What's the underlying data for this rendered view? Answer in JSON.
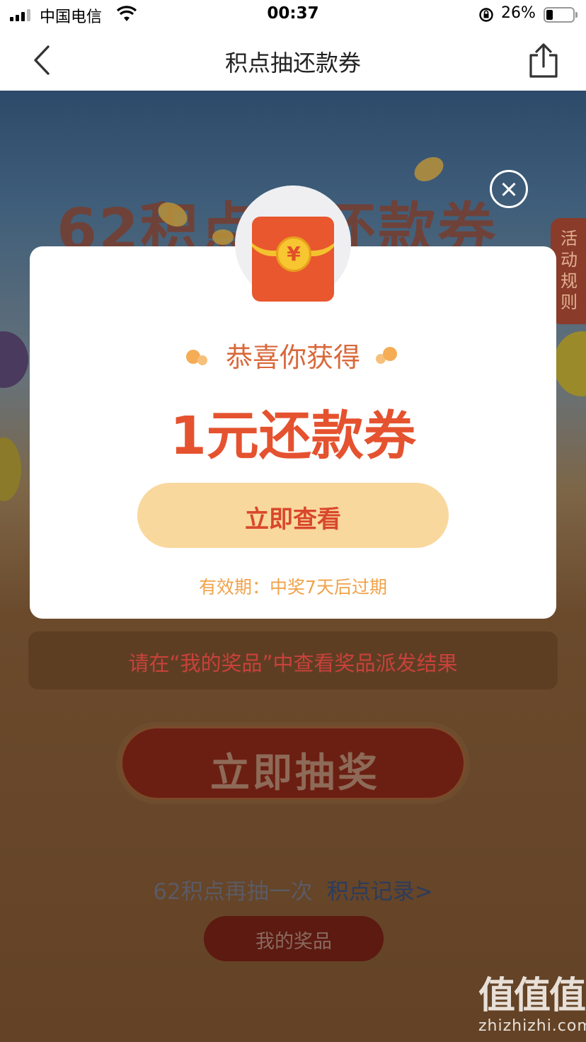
{
  "status_bar": {
    "carrier": "中国电信",
    "time": "00:37",
    "battery_percent": "26%",
    "battery_level": 0.26
  },
  "nav": {
    "title": "积点抽还款券",
    "back_icon": "chevron-left-icon",
    "share_icon": "share-icon"
  },
  "background": {
    "headline": "62积点抽还款券",
    "rules_tab": "活动规则",
    "notice": "请在“我的奖品”中查看奖品派发结果",
    "draw_button": "立即抽奖",
    "again_text": "62积点再抽一次",
    "record_link": "积点记录>",
    "my_prizes_button": "我的奖品"
  },
  "modal": {
    "congrats": "恭喜你获得",
    "prize": "1元还款券",
    "view_button": "立即查看",
    "validity": "有效期：中奖7天后过期",
    "yen_symbol": "¥",
    "close_icon": "close-icon"
  },
  "watermark": {
    "logo": "值值值",
    "url": "zhizhizhi.com"
  },
  "colors": {
    "accent_red": "#e5522f",
    "button_yellow": "#f9d89e",
    "validity_orange": "#f0a24a"
  }
}
